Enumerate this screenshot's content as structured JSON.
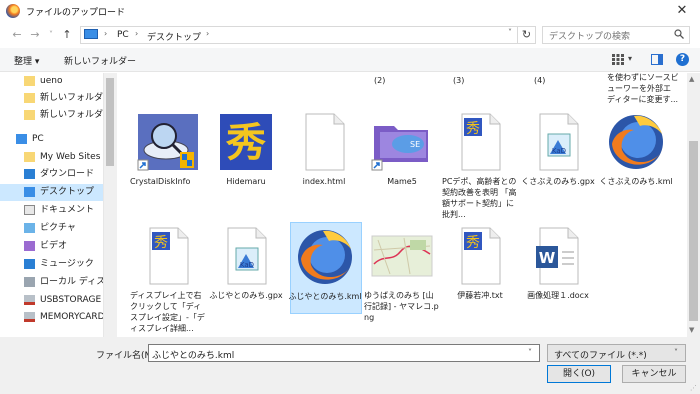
{
  "window": {
    "title": "ファイルのアップロード",
    "close_glyph": "✕"
  },
  "nav": {
    "back": "←",
    "forward": "→",
    "recent": "˅",
    "up": "↑"
  },
  "address": {
    "crumbs": [
      "PC",
      "デスクトップ"
    ],
    "sep": "›",
    "dropdown": "˅",
    "refresh": "↻"
  },
  "search": {
    "placeholder": "デスクトップの検索"
  },
  "toolbar": {
    "organize_label": "整理 ▾",
    "new_folder_label": "新しいフォルダー",
    "view_dd": "▾",
    "help": "?"
  },
  "sidebar": {
    "items": [
      {
        "label": "ueno",
        "icon": "folder-icon"
      },
      {
        "label": "新しいフォルダー",
        "icon": "folder-icon"
      },
      {
        "label": "新しいフォルダー (4",
        "icon": "folder-icon"
      },
      {
        "label": "PC",
        "icon": "pc-icon"
      },
      {
        "label": "My Web Sites on",
        "icon": "folder-icon"
      },
      {
        "label": "ダウンロード",
        "icon": "download-icon"
      },
      {
        "label": "デスクトップ",
        "icon": "desktop-icon"
      },
      {
        "label": "ドキュメント",
        "icon": "document-icon"
      },
      {
        "label": "ピクチャ",
        "icon": "picture-icon"
      },
      {
        "label": "ビデオ",
        "icon": "video-icon"
      },
      {
        "label": "ミュージック",
        "icon": "music-icon"
      },
      {
        "label": "ローカル ディスク (C",
        "icon": "disk-icon"
      },
      {
        "label": "USBSTORAGE (¥¥",
        "icon": "network-drive-icon"
      },
      {
        "label": "MEMORYCARD (¥",
        "icon": "network-drive-icon"
      }
    ]
  },
  "top_labels": [
    "(2)",
    "(3)",
    "(4)",
    "を使わずにソースビ\nューワーを外部エ\nディターに変更す..."
  ],
  "files": [
    {
      "name": "CrystalDiskInfo",
      "icon": "crystaldiskinfo-icon"
    },
    {
      "name": "Hidemaru",
      "icon": "hidemaru-icon"
    },
    {
      "name": "index.html",
      "icon": "html-file-icon"
    },
    {
      "name": "Mame5",
      "icon": "folder-shortcut-icon"
    },
    {
      "name": "PCデポ、高齢者との契約改善を表明 「高額サポート契約」に批判...",
      "icon": "text-file-icon"
    },
    {
      "name": "くさぶえのみち.gpx",
      "icon": "gpx-file-icon"
    },
    {
      "name": "くさぶえのみち.kml",
      "icon": "firefox-kml-icon"
    },
    {
      "name": "ディスプレイ上で右クリックして「ディスプレイ設定」-「ディスプレイ詳細...",
      "icon": "text-file-icon"
    },
    {
      "name": "ふじやとのみち.gpx",
      "icon": "gpx-file-icon"
    },
    {
      "name": "ふじやとのみち.kml",
      "icon": "firefox-kml-icon"
    },
    {
      "name": "ゆうばえのみち [山行記録] - ヤマレコ.png",
      "icon": "map-image-icon"
    },
    {
      "name": "伊藤若冲.txt",
      "icon": "text-file-icon"
    },
    {
      "name": "画像処理１.docx",
      "icon": "word-file-icon"
    }
  ],
  "bottom": {
    "filename_label": "ファイル名(N):",
    "filename_value": "ふじやとのみち.kml",
    "filter_value": "すべてのファイル (*.*)",
    "open_label": "開く(O)",
    "cancel_label": "キャンセル",
    "dd": "˅"
  },
  "colors": {
    "selection": "#cce8ff",
    "accent": "#0078d7"
  }
}
